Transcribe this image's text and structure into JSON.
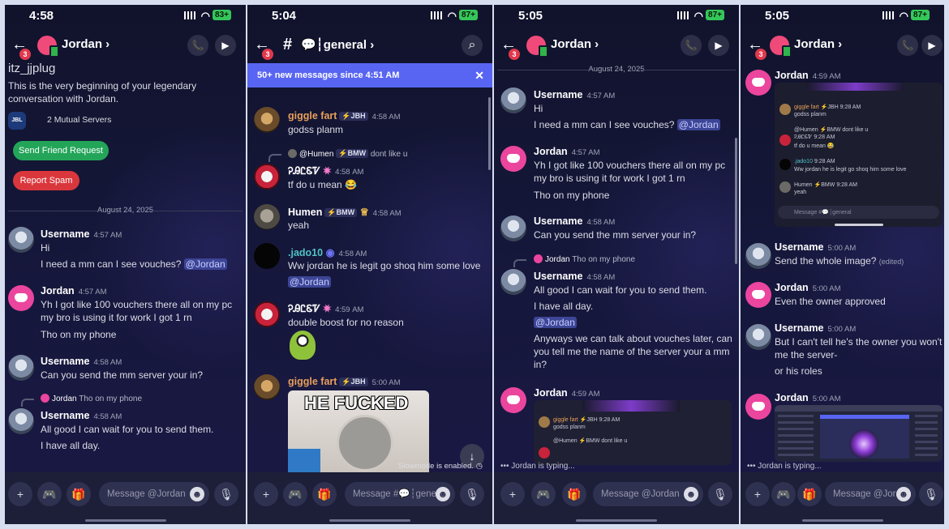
{
  "panels": [
    {
      "status": {
        "time": "4:58",
        "battery": "83+"
      },
      "header": {
        "badge": "3",
        "title": "Jordan ›"
      },
      "intro": {
        "handle": "itz_jjplug",
        "line1": "This is the very beginning of your legendary",
        "line2": "conversation with Jordan.",
        "mutual": "2 Mutual Servers",
        "friend_btn": "Send Friend Request",
        "spam_btn": "Report Spam"
      },
      "date": "August 24, 2025",
      "messages": [
        {
          "name": "Username",
          "time": "4:57 AM",
          "line1": "Hi",
          "line2": "I need a mm can I see vouches?",
          "mention": "@Jordan"
        },
        {
          "name": "Jordan",
          "time": "4:57 AM",
          "line1": "Yh I got like 100 vouchers there all on my pc",
          "line2": "my bro is using it for work I got 1 rn",
          "line3": "Tho on my phone"
        },
        {
          "name": "Username",
          "time": "4:58 AM",
          "line1": "Can you send the mm server your in?"
        },
        {
          "reply_name": "Jordan",
          "reply_text": "Tho on my phone",
          "name": "Username",
          "time": "4:58 AM",
          "line1": "All good I can wait for you to send them.",
          "line2": "I have all day."
        }
      ],
      "placeholder": "Message @Jordan"
    },
    {
      "status": {
        "time": "5:04",
        "battery": "87+"
      },
      "header": {
        "badge": "3",
        "title": "💬┆general ›"
      },
      "banner": "50+ new messages since 4:51 AM",
      "banner_close": "✕",
      "messages": [
        {
          "name": "giggle fart",
          "tag": "⚡JBH",
          "time": "4:58 AM",
          "text": "godss planm"
        },
        {
          "reply_name": "@Humen",
          "reply_tag": "⚡BMW",
          "reply_text": "dont like u",
          "name": "ᎮᎯᏝᏋᏤ",
          "time": "4:58 AM",
          "text": "tf do u mean 😂"
        },
        {
          "name": "Humen",
          "tag": "⚡BMW",
          "time": "4:58 AM",
          "text": "yeah"
        },
        {
          "name": ".jado10",
          "time": "4:58 AM",
          "text": "Ww jordan he is legit go shoq him some love",
          "mention": "@Jordan"
        },
        {
          "name": "ᎮᎯᏝᏋᏤ",
          "time": "4:59 AM",
          "text": "double boost for no reason"
        },
        {
          "name": "giggle fart",
          "tag": "⚡JBH",
          "time": "5:00 AM",
          "meme_caption": "HE FUCKED"
        }
      ],
      "slowmode": "Slowmode is enabled.",
      "placeholder": "Message #💬┆general"
    },
    {
      "status": {
        "time": "5:05",
        "battery": "87+"
      },
      "header": {
        "badge": "3",
        "title": "Jordan ›"
      },
      "date": "August 24, 2025",
      "messages": [
        {
          "name": "Username",
          "time": "4:57 AM",
          "line1": "Hi",
          "line2": "I need a mm can I see vouches?",
          "mention": "@Jordan"
        },
        {
          "name": "Jordan",
          "time": "4:57 AM",
          "line1": "Yh I got like 100 vouchers there all on my pc",
          "line2": "my bro is using it for work I got 1 rn",
          "line3": "Tho on my phone"
        },
        {
          "name": "Username",
          "time": "4:58 AM",
          "line1": "Can you send the mm server your in?"
        },
        {
          "reply_name": "Jordan",
          "reply_text": "Tho on my phone",
          "name": "Username",
          "time": "4:58 AM",
          "line1": "All good I can wait for you to send them.",
          "line2": "I have all day.",
          "mention": "@Jordan",
          "line3": "Anyways we can talk about vouches later, can",
          "line4": "you tell me the name of the server your a mm",
          "line5": "in?"
        },
        {
          "name": "Jordan",
          "time": "4:59 AM",
          "embed_name": "giggle fart",
          "embed_tag": "⚡JBH",
          "embed_time": "9:28 AM",
          "embed_text": "godss planm",
          "embed_reply": "@Humen",
          "embed_reply_tag": "⚡BMW",
          "embed_reply_text": "dont like u"
        }
      ],
      "typing": "Jordan is typing...",
      "placeholder": "Message @Jordan"
    },
    {
      "status": {
        "time": "5:05",
        "battery": "87+"
      },
      "header": {
        "badge": "3",
        "title": "Jordan ›"
      },
      "messages": [
        {
          "name": "Jordan",
          "time": "4:59 AM",
          "embed": {
            "m1_name": "giggle fart",
            "m1_tag": "⚡JBH",
            "m1_time": "9:28 AM",
            "m1_text": "godss planm",
            "m2_reply": "@Humen",
            "m2_reply_tag": "⚡BMW",
            "m2_reply_text": "dont like u",
            "m2_name": "ᎮᎯᏝᏋᏤ",
            "m2_time": "9:28 AM",
            "m2_text": "tf do u mean 😂",
            "m3_name": ".jado10",
            "m3_time": "9:28 AM",
            "m3_text": "Ww jordan he is legit go shoq him some love",
            "m4_name": "Humen",
            "m4_tag": "⚡BMW",
            "m4_time": "9:28 AM",
            "m4_text": "yeah",
            "placeholder": "Message #💬┆general"
          }
        },
        {
          "name": "Username",
          "time": "5:00 AM",
          "text": "Send the whole image?",
          "edited": "(edited)"
        },
        {
          "name": "Jordan",
          "time": "5:00 AM",
          "text": "Even the owner approved"
        },
        {
          "name": "Username",
          "time": "5:00 AM",
          "line1": "But I can't tell he's the owner you won't show",
          "line2": "me the server-",
          "line3": "or his roles"
        },
        {
          "name": "Jordan",
          "time": "5:00 AM"
        }
      ],
      "typing": "Jordan is typing...",
      "placeholder": "Message @Jordan"
    }
  ],
  "icons": {
    "add": "+",
    "gamepad": "🎮",
    "gift": "🎁",
    "emoji": "☻",
    "mic": "🎙",
    "call": "📞",
    "video": "▶",
    "search": "⌕",
    "back": "←",
    "scroll_down": "↓"
  }
}
